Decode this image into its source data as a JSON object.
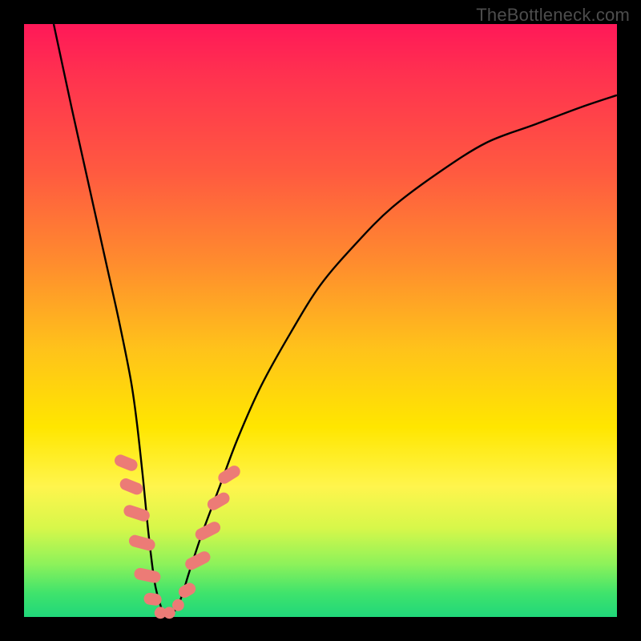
{
  "watermark": "TheBottleneck.com",
  "chart_data": {
    "type": "line",
    "title": "",
    "xlabel": "",
    "ylabel": "",
    "xlim": [
      0,
      100
    ],
    "ylim": [
      0,
      100
    ],
    "grid": false,
    "legend": false,
    "series": [
      {
        "name": "curve",
        "color": "#000000",
        "x": [
          5,
          8,
          10,
          12,
          14,
          16,
          18,
          19,
          20,
          21,
          22,
          23,
          24,
          26,
          28,
          30,
          33,
          36,
          40,
          45,
          50,
          56,
          62,
          70,
          78,
          86,
          94,
          100
        ],
        "y": [
          100,
          86,
          77,
          68,
          59,
          50,
          40,
          33,
          24,
          14,
          6,
          2,
          0,
          2,
          8,
          14,
          22,
          30,
          39,
          48,
          56,
          63,
          69,
          75,
          80,
          83,
          86,
          88
        ]
      }
    ],
    "markers": [
      {
        "name": "points",
        "shape": "rounded-rect",
        "color": "#ec7b76",
        "items": [
          {
            "x": 17.2,
            "y": 26.0,
            "w": 2.0,
            "h": 4.0,
            "rot": -68
          },
          {
            "x": 18.1,
            "y": 22.0,
            "w": 2.0,
            "h": 4.0,
            "rot": -68
          },
          {
            "x": 19.0,
            "y": 17.5,
            "w": 2.0,
            "h": 4.5,
            "rot": -72
          },
          {
            "x": 19.9,
            "y": 12.5,
            "w": 2.0,
            "h": 4.5,
            "rot": -75
          },
          {
            "x": 20.8,
            "y": 7.0,
            "w": 2.0,
            "h": 4.5,
            "rot": -78
          },
          {
            "x": 21.7,
            "y": 3.0,
            "w": 2.0,
            "h": 3.0,
            "rot": -82
          },
          {
            "x": 23.0,
            "y": 0.7,
            "w": 2.0,
            "h": 2.0,
            "rot": 0
          },
          {
            "x": 24.5,
            "y": 0.7,
            "w": 2.0,
            "h": 2.0,
            "rot": 0
          },
          {
            "x": 26.0,
            "y": 2.0,
            "w": 2.0,
            "h": 2.0,
            "rot": 0
          },
          {
            "x": 27.5,
            "y": 4.5,
            "w": 2.0,
            "h": 3.0,
            "rot": 60
          },
          {
            "x": 29.3,
            "y": 9.5,
            "w": 2.0,
            "h": 4.5,
            "rot": 63
          },
          {
            "x": 31.0,
            "y": 14.5,
            "w": 2.0,
            "h": 4.5,
            "rot": 63
          },
          {
            "x": 32.8,
            "y": 19.5,
            "w": 2.0,
            "h": 4.0,
            "rot": 60
          },
          {
            "x": 34.6,
            "y": 24.0,
            "w": 2.0,
            "h": 4.0,
            "rot": 58
          }
        ]
      }
    ]
  }
}
